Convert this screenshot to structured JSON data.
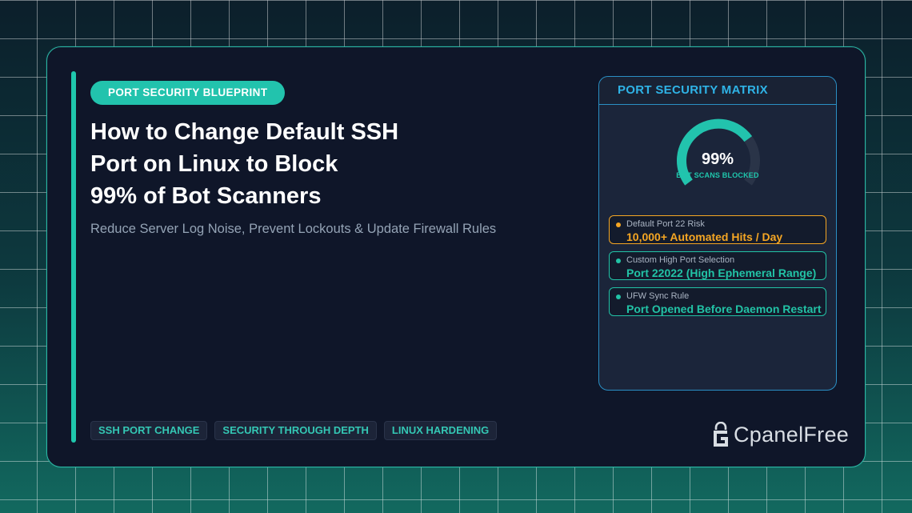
{
  "badge": "PORT SECURITY BLUEPRINT",
  "title_lines": [
    "How to Change Default SSH",
    "Port on Linux to Block",
    "99% of Bot Scanners"
  ],
  "subtitle": "Reduce Server Log Noise, Prevent Lockouts & Update Firewall Rules",
  "tags": [
    "SSH PORT CHANGE",
    "SECURITY THROUGH DEPTH",
    "LINUX HARDENING"
  ],
  "matrix": {
    "title": "PORT SECURITY MATRIX",
    "gauge": {
      "value_text": "99%",
      "value": 0.99,
      "label": "BOT SCANS BLOCKED"
    },
    "rows": [
      {
        "label": "Default Port 22 Risk",
        "value": "10,000+ Automated Hits / Day",
        "color": "#f5a623"
      },
      {
        "label": "Custom High Port Selection",
        "value": "Port 22022 (High Ephemeral Range)",
        "color": "#22c3a6"
      },
      {
        "label": "UFW Sync Rule",
        "value": "Port Opened Before Daemon Restart",
        "color": "#22c3a6"
      }
    ]
  },
  "brand": "CpanelFree",
  "colors": {
    "accent": "#1fc7ad",
    "warning": "#f5a623",
    "panel_border": "#2a8fc4"
  }
}
